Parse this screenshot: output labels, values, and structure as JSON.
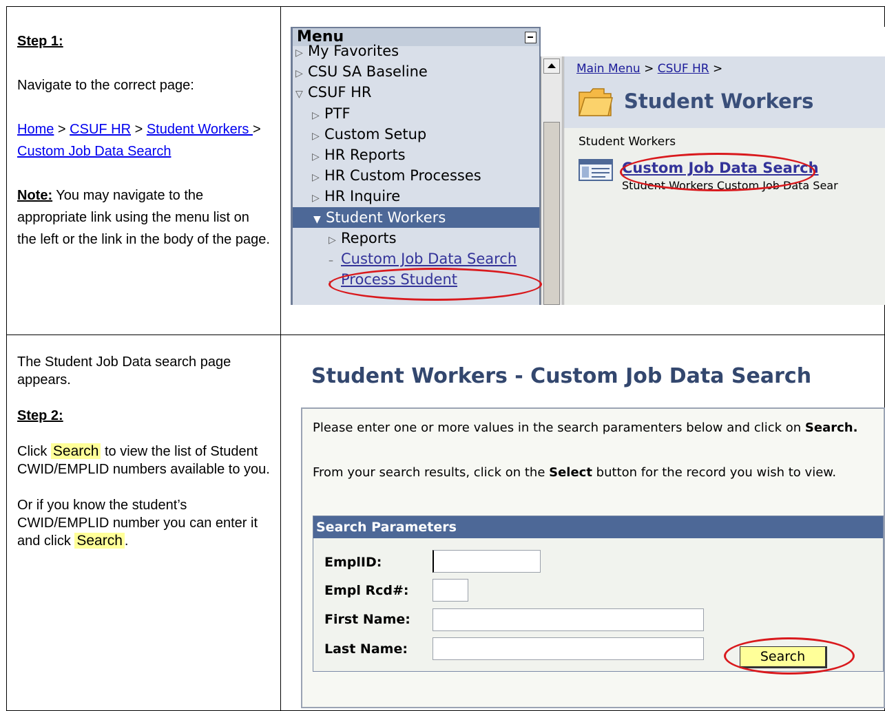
{
  "step1": {
    "label": "Step 1:",
    "intro": "Navigate to the correct page:",
    "nav": {
      "home": "Home",
      "sep": " > ",
      "csuf_hr": "CSUF HR",
      "student_workers": "Student Workers ",
      "custom_job": "Custom Job Data Search"
    },
    "note_label": "Note:",
    "note_text": " You may navigate to the appropriate link using the menu list on the left or the link in the body of the page.",
    "screenshot": {
      "menu_title": "Menu",
      "menu_items": [
        {
          "label": "My Favorites",
          "indicator": "▷"
        },
        {
          "label": "CSU SA Baseline",
          "indicator": "▷"
        },
        {
          "label": "CSUF HR",
          "indicator": "▽"
        },
        {
          "label": "PTF",
          "indicator": "▷"
        },
        {
          "label": "Custom Setup",
          "indicator": "▷"
        },
        {
          "label": "HR Reports",
          "indicator": "▷"
        },
        {
          "label": "HR Custom Processes",
          "indicator": "▷"
        },
        {
          "label": "HR Inquire",
          "indicator": "▷"
        },
        {
          "label": "Student Workers",
          "indicator": "▼"
        },
        {
          "label": "Reports",
          "indicator": "▷"
        },
        {
          "label": "Custom Job Data Search",
          "indicator": "–"
        },
        {
          "label": "Process Student",
          "indicator": "–"
        }
      ],
      "breadcrumb_main": "Main Menu",
      "breadcrumb_sep": " > ",
      "breadcrumb_csuf": "CSUF HR",
      "breadcrumb_tail": " >",
      "section_title": "Student Workers",
      "section_sub": "Student Workers",
      "link_title": "Custom Job Data Search",
      "link_desc": "Student Workers Custom Job Data Sear"
    }
  },
  "step2": {
    "intro": "The Student Job Data search page appears.",
    "label": "Step 2:",
    "click": "Click ",
    "search_word": "Search",
    "click_rest": " to view the list of Student CWID/EMPLID numbers available to you.",
    "or_text": "Or if you know the student’s CWID/EMPLID number you can enter it and click ",
    "period": ".",
    "screenshot": {
      "page_title": "Student Workers - Custom Job Data Search",
      "instr1_a": "Please enter one or more values in the search paramenters below and click on ",
      "instr1_b": "Search.",
      "instr2_a": "From your search results, click on the ",
      "instr2_b": "Select",
      "instr2_c": " button for the record you wish to view.",
      "params_header": "Search Parameters",
      "fields": {
        "emplid": {
          "label": "EmplID:",
          "value": ""
        },
        "empl_rcd": {
          "label": "Empl Rcd#:",
          "value": ""
        },
        "first_name": {
          "label": "First Name:",
          "value": ""
        },
        "last_name": {
          "label": "Last Name:",
          "value": ""
        }
      },
      "search_button": "Search"
    }
  },
  "colors": {
    "highlight": "#ffff99",
    "annotation_red": "#d9191d",
    "peoplesoft_blue": "#4d6897",
    "link_blue": "#0000ee"
  }
}
